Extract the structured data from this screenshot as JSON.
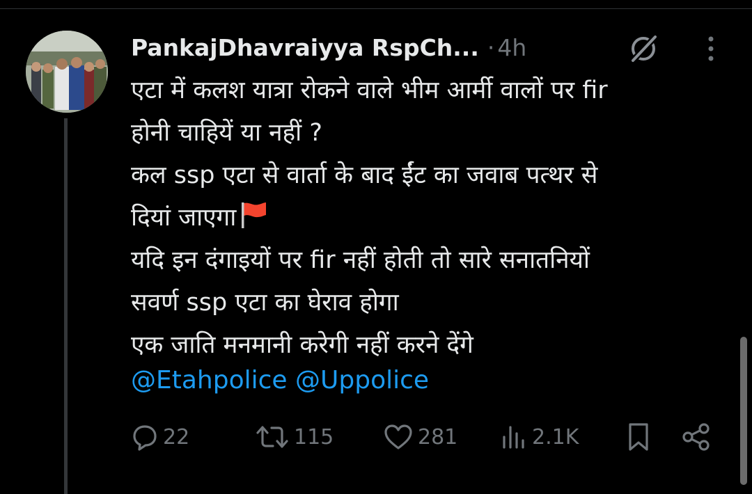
{
  "tweet": {
    "author_name": "PankajDhavraiyya RspCh...",
    "separator": "·",
    "timestamp": "4h",
    "lines": [
      "एटा में कलश यात्रा रोकने वाले भीम आर्मी वालों पर fir",
      "होनी चाहियें या नहीं ?",
      "कल ssp एटा से वार्ता के बाद ईंट का जवाब पत्थर से",
      "दियां जाएगा",
      "यदि इन दंगाइयों पर fir नहीं होती तो सारे सनातनियों",
      "सवर्ण ssp एटा का घेराव होगा",
      "एक जाति मनमानी करेगी नहीं करने देंगे"
    ],
    "mentions": [
      "@Etahpolice",
      "@Uppolice"
    ]
  },
  "actions": {
    "replies": "22",
    "reposts": "115",
    "likes": "281",
    "views": "2.1K"
  },
  "icons": {
    "header": [
      "grok-icon",
      "more-vertical-icon"
    ],
    "inline": "red-flag-emoji",
    "actions": [
      "reply-icon",
      "repost-icon",
      "like-icon",
      "views-icon",
      "bookmark-icon",
      "share-icon"
    ]
  },
  "colors": {
    "background": "#000000",
    "text": "#e7e9ea",
    "secondary": "#71767b",
    "link": "#1d9bf0",
    "thread_line": "#333639",
    "flag": "#f4442e"
  }
}
